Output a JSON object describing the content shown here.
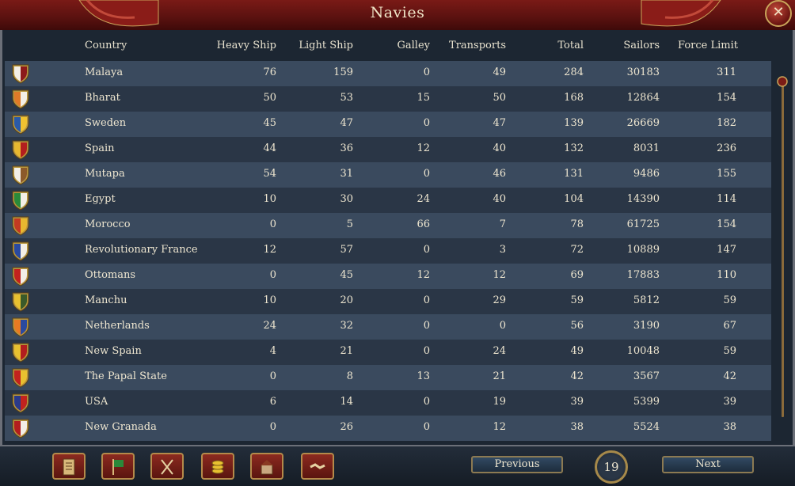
{
  "window": {
    "title": "Navies",
    "close_icon": "close-x-icon"
  },
  "columns": {
    "country": "Country",
    "heavy": "Heavy Ship",
    "light": "Light Ship",
    "galley": "Galley",
    "transports": "Transports",
    "total": "Total",
    "sailors": "Sailors",
    "force_limit": "Force Limit"
  },
  "rows": [
    {
      "country": "Malaya",
      "heavy": "76",
      "light": "159",
      "galley": "0",
      "transports": "49",
      "total": "284",
      "sailors": "30183",
      "force_limit": "311",
      "flag": [
        "#f3efe6",
        "#8c1a1a"
      ]
    },
    {
      "country": "Bharat",
      "heavy": "50",
      "light": "53",
      "galley": "15",
      "transports": "50",
      "total": "168",
      "sailors": "12864",
      "force_limit": "154",
      "flag": [
        "#e07a28",
        "#f3efe6"
      ]
    },
    {
      "country": "Sweden",
      "heavy": "45",
      "light": "47",
      "galley": "0",
      "transports": "47",
      "total": "139",
      "sailors": "26669",
      "force_limit": "182",
      "flag": [
        "#2a5aa8",
        "#f0c230"
      ]
    },
    {
      "country": "Spain",
      "heavy": "44",
      "light": "36",
      "galley": "12",
      "transports": "40",
      "total": "132",
      "sailors": "8031",
      "force_limit": "236",
      "flag": [
        "#e8b830",
        "#b21e1e"
      ]
    },
    {
      "country": "Mutapa",
      "heavy": "54",
      "light": "31",
      "galley": "0",
      "transports": "46",
      "total": "131",
      "sailors": "9486",
      "force_limit": "155",
      "flag": [
        "#f3efe6",
        "#8c5a2a"
      ]
    },
    {
      "country": "Egypt",
      "heavy": "10",
      "light": "30",
      "galley": "24",
      "transports": "40",
      "total": "104",
      "sailors": "14390",
      "force_limit": "114",
      "flag": [
        "#2a8a3a",
        "#f3efe6"
      ]
    },
    {
      "country": "Morocco",
      "heavy": "0",
      "light": "5",
      "galley": "66",
      "transports": "7",
      "total": "78",
      "sailors": "61725",
      "force_limit": "154",
      "flag": [
        "#c23a22",
        "#e8b830"
      ]
    },
    {
      "country": "Revolutionary France",
      "heavy": "12",
      "light": "57",
      "galley": "0",
      "transports": "3",
      "total": "72",
      "sailors": "10889",
      "force_limit": "147",
      "flag": [
        "#2a4aa0",
        "#f3efe6"
      ]
    },
    {
      "country": "Ottomans",
      "heavy": "0",
      "light": "45",
      "galley": "12",
      "transports": "12",
      "total": "69",
      "sailors": "17883",
      "force_limit": "110",
      "flag": [
        "#c2221e",
        "#f3efe6"
      ]
    },
    {
      "country": "Manchu",
      "heavy": "10",
      "light": "20",
      "galley": "0",
      "transports": "29",
      "total": "59",
      "sailors": "5812",
      "force_limit": "59",
      "flag": [
        "#e8c030",
        "#3a5a2a"
      ]
    },
    {
      "country": "Netherlands",
      "heavy": "24",
      "light": "32",
      "galley": "0",
      "transports": "0",
      "total": "56",
      "sailors": "3190",
      "force_limit": "67",
      "flag": [
        "#e87a22",
        "#2a4aa0"
      ]
    },
    {
      "country": "New Spain",
      "heavy": "4",
      "light": "21",
      "galley": "0",
      "transports": "24",
      "total": "49",
      "sailors": "10048",
      "force_limit": "59",
      "flag": [
        "#e8c030",
        "#b21e1e"
      ]
    },
    {
      "country": "The Papal State",
      "heavy": "0",
      "light": "8",
      "galley": "13",
      "transports": "21",
      "total": "42",
      "sailors": "3567",
      "force_limit": "42",
      "flag": [
        "#c2221e",
        "#e8c030"
      ]
    },
    {
      "country": "USA",
      "heavy": "6",
      "light": "14",
      "galley": "0",
      "transports": "19",
      "total": "39",
      "sailors": "5399",
      "force_limit": "39",
      "flag": [
        "#2a3a8a",
        "#c2221e"
      ]
    },
    {
      "country": "New Granada",
      "heavy": "0",
      "light": "26",
      "galley": "0",
      "transports": "12",
      "total": "38",
      "sailors": "5524",
      "force_limit": "38",
      "flag": [
        "#b21e1e",
        "#f3efe6"
      ]
    }
  ],
  "footer": {
    "previous": "Previous",
    "next": "Next",
    "page": "19",
    "buttons": [
      "ledger-icon",
      "flag-icon",
      "crossed-swords-icon",
      "coins-icon",
      "buildings-icon",
      "handshake-icon"
    ]
  },
  "colors": {
    "header_red": "#6a1410",
    "row_light": "#3a4a5e",
    "row_dark": "#2a3646",
    "gold_trim": "#b48a4a"
  }
}
